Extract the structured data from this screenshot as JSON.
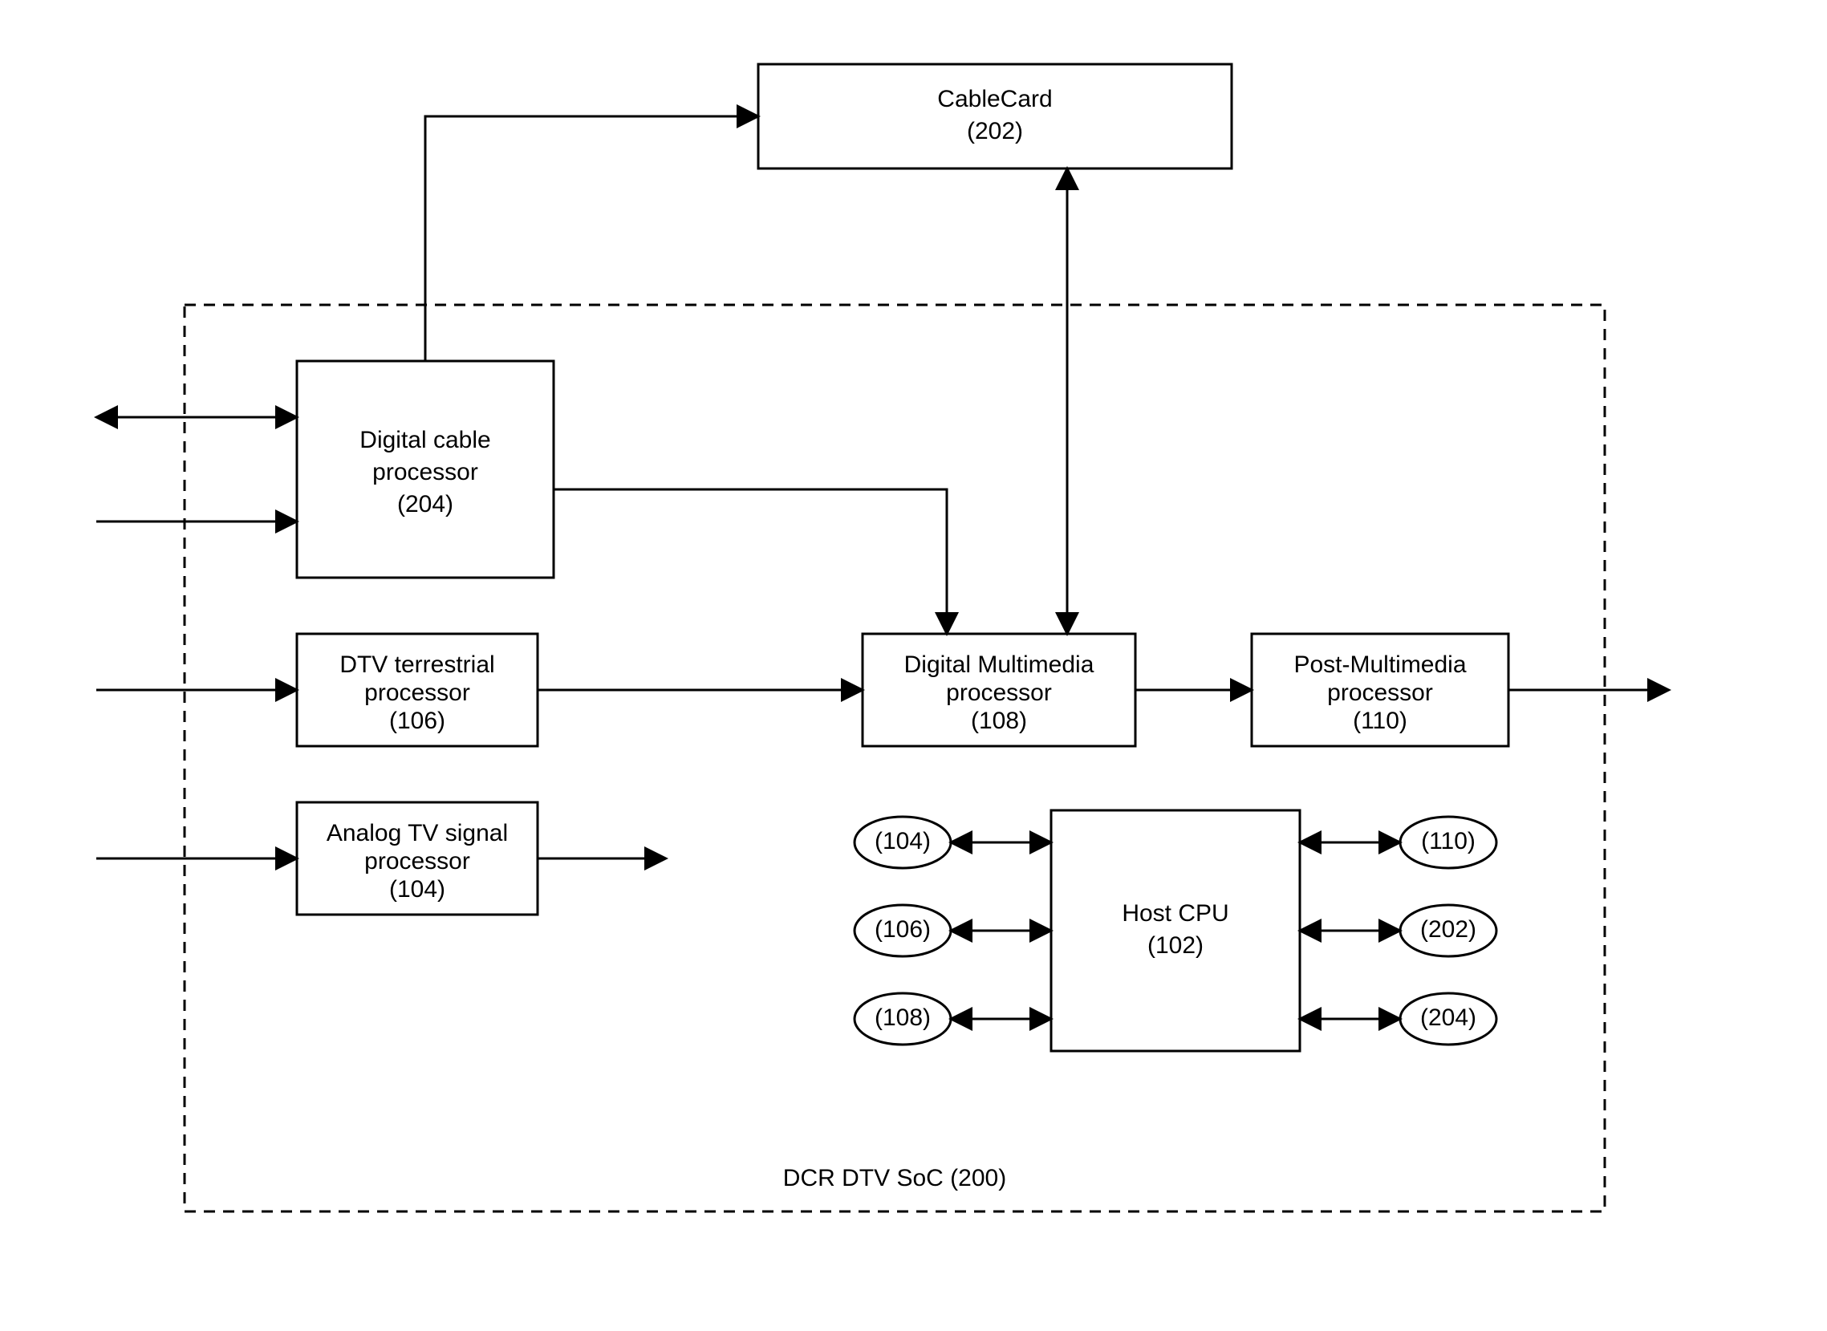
{
  "blocks": {
    "cablecard": {
      "l1": "CableCard",
      "l2": "(202)"
    },
    "dcp": {
      "l1": "Digital cable",
      "l2": "processor",
      "l3": "(204)"
    },
    "dtv": {
      "l1": "DTV terrestrial",
      "l2": "processor",
      "l3": "(106)"
    },
    "analog": {
      "l1": "Analog TV signal",
      "l2": "processor",
      "l3": "(104)"
    },
    "dmm": {
      "l1": "Digital Multimedia",
      "l2": "processor",
      "l3": "(108)"
    },
    "pmm": {
      "l1": "Post-Multimedia",
      "l2": "processor",
      "l3": "(110)"
    },
    "host": {
      "l1": "Host CPU",
      "l2": "(102)"
    }
  },
  "ellipses": {
    "e104": "(104)",
    "e106": "(106)",
    "e108": "(108)",
    "e110": "(110)",
    "e202": "(202)",
    "e204": "(204)"
  },
  "soc_label": "DCR DTV SoC (200)"
}
